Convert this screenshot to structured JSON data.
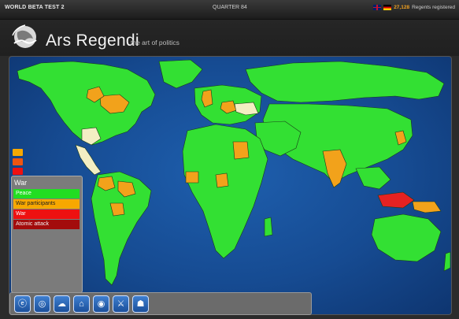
{
  "topbar": {
    "left_text": "WORLD BETA TEST 2",
    "center_text": "QUARTER 84",
    "regents_count": "27,128",
    "regents_label": "Regents registered",
    "flags": [
      "uk-flag",
      "de-flag"
    ]
  },
  "header": {
    "title": "Ars Regendi",
    "subtitle": "the art of politics",
    "logo_icon": "globe-hand-icon"
  },
  "legend": {
    "title": "War",
    "items": [
      {
        "label": "Peace",
        "color": "#22dd22"
      },
      {
        "label": "War participants",
        "color": "#f7a800"
      },
      {
        "label": "War",
        "color": "#ee1111"
      },
      {
        "label": "Atomic attack",
        "color": "#a30c0c"
      }
    ]
  },
  "side_stack_colors": [
    "#f7a800",
    "#ee5511",
    "#ee1111"
  ],
  "toolbar": {
    "tools": [
      {
        "name": "tool-economy-button",
        "icon": "ⓔ"
      },
      {
        "name": "tool-population-button",
        "icon": "◎"
      },
      {
        "name": "tool-weather-button",
        "icon": "☁"
      },
      {
        "name": "tool-government-button",
        "icon": "⌂"
      },
      {
        "name": "tool-world-button",
        "icon": "◉"
      },
      {
        "name": "tool-military-button",
        "icon": "⚔"
      },
      {
        "name": "tool-people-button",
        "icon": "☗"
      }
    ]
  },
  "map_colors": {
    "ocean": "#164b92",
    "peace": "#33e033",
    "participant": "#f2a21b",
    "war": "#e52222",
    "neutral": "#f3eec3"
  }
}
